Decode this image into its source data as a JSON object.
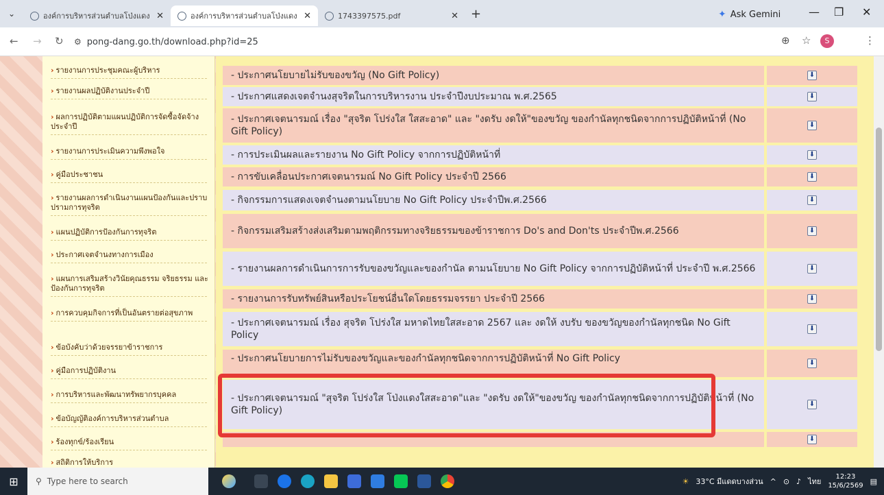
{
  "browser": {
    "tabs": [
      {
        "label": "องค์การบริหารส่วนตำบลโป่งแดง อ.ร"
      },
      {
        "label": "องค์การบริหารส่วนตำบลโป่งแดง อ.ร"
      },
      {
        "label": "1743397575.pdf"
      }
    ],
    "gemini_label": "Ask Gemini",
    "url": "pong-dang.go.th/download.php?id=25",
    "profile_initial": "S"
  },
  "sidebar": {
    "items": [
      {
        "label": "รายงานการประชุมคณะผู้บริหาร"
      },
      {
        "label": "รายงานผลปฏิบัติงานประจำปี"
      },
      {
        "label": "ผลการปฏิบัติตามแผนปฏิบัติการจัดซื้อจัดจ้างประจำปี"
      },
      {
        "label": "รายงานการประเมินความพึงพอใจ"
      },
      {
        "label": "คู่มือประชาชน"
      },
      {
        "label": "รายงานผลการดำเนินงานแผนป้องกันและปราบปรามการทุจริต"
      },
      {
        "label": "แผนปฏิบัติการป้องกันการทุจริต"
      },
      {
        "label": "ประกาศเจตจำนงทางการเมือง"
      },
      {
        "label": "แผนการเสริมสร้างวินัยคุณธรรม จริยธรรม และป้องกันการทุจริต"
      },
      {
        "label": "การควบคุมกิจการที่เป็นอันตรายต่อสุขภาพ"
      },
      {
        "label": "ข้อบังคับว่าด้วยจรรยาข้าราชการ"
      },
      {
        "label": "คู่มือการปฏิบัติงาน"
      },
      {
        "label": "การบริหารและพัฒนาทรัพยากรบุคคล"
      },
      {
        "label": "ข้อบัญญัติองค์การบริหารส่วนตำบล"
      },
      {
        "label": "ร้องทุกข์/ร้องเรียน"
      },
      {
        "label": "สถิติการให้บริการ"
      }
    ]
  },
  "documents": {
    "rows": [
      {
        "title": "- ประกาศนโยบายไม่รับของขวัญ (No Gift Policy)"
      },
      {
        "title": "- ประกาศแสดงเจตจำนงสุจริตในการบริหารงาน ประจำปีงบประมาณ พ.ศ.2565"
      },
      {
        "title": "- ประกาศเจตนารมณ์ เรื่อง \"สุจริต โปร่งใส ใสสะอาด\" และ \"งดรับ งดให้\"ของขวัญ ของกำนัลทุกชนิดจากการปฏิบัติหน้าที่ (No Gift Policy)"
      },
      {
        "title": "- การประเมินผลและรายงาน No Gift Policy จากการปฏิบัติหน้าที่"
      },
      {
        "title": "- การขับเคลื่อนประกาศเจตนารมณ์ No Gift Policy ประจำปี 2566"
      },
      {
        "title": "- กิจกรรมการแสดงเจตจำนงตามนโยบาย No Gift Policy ประจำปีพ.ศ.2566"
      },
      {
        "title": "- กิจกรรมเสริมสร้างส่งเสริมตามพฤติกรรมทางจริยธรรมของข้าราชการ Do's and Don'ts ประจำปีพ.ศ.2566"
      },
      {
        "title": "- รายงานผลการดำเนินการการรับของขวัญและของกำนัล ตามนโยบาย No Gift Policy จากการปฏิบัติหน้าที่ ประจำปี พ.ศ.2566"
      },
      {
        "title": "- รายงานการรับทรัพย์สินหรือประโยชน์อื่นใดโดยธรรมจรรยา ประจำปี 2566"
      },
      {
        "title": "- ประกาศเจตนารมณ์ เรื่อง สุจริต โปร่งใส มหาดไทยใสสะอาด 2567 และ งดให้ งบรับ ของขวัญของกำนัลทุกชนิด No Gift Policy"
      },
      {
        "title": "- ประกาศนโยบายการไม่รับของขวัญและของกำนัลทุกชนิดจากการปฏิบัติหน้าที่ No Gift Policy"
      },
      {
        "title": "- ประกาศเจตนารมณ์ \"สุจริต โปร่งใส โป่งแดงใสสะอาด\"และ \"งดรับ งดให้\"ของขวัญ ของกำนัลทุกชนิดจากการปฏิบัติหน้าที่ (No Gift Policy)"
      },
      {
        "title": ""
      }
    ]
  },
  "taskbar": {
    "search_placeholder": "Type here to search",
    "weather": "33°C มีแดดบางส่วน",
    "lang": "ไทย",
    "time": "12:23",
    "date": "15/6/2569"
  },
  "colors": {
    "row_pink": "#f7cdbe",
    "row_lavender": "#e4e1f1",
    "highlight": "#e53935",
    "sidebar_bg": "#fffcd9",
    "content_bg": "#fbf2a8"
  }
}
